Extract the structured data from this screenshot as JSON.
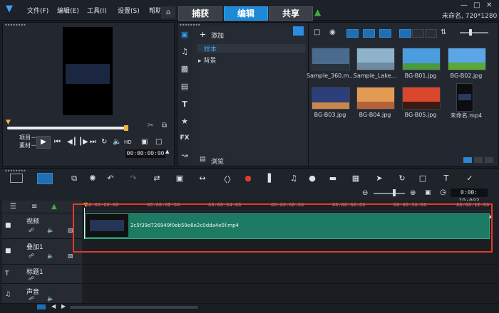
{
  "menu": {
    "items": [
      {
        "label": "文件(F)"
      },
      {
        "label": "编辑(E)"
      },
      {
        "label": "工具(I)"
      },
      {
        "label": "设置(S)"
      },
      {
        "label": "帮助"
      }
    ]
  },
  "tabs": [
    {
      "label": "捕获",
      "active": false
    },
    {
      "label": "编辑",
      "active": true
    },
    {
      "label": "共享",
      "active": false
    }
  ],
  "project_info": "未命名, 720*1280",
  "preview": {
    "mode_project": "项目－",
    "mode_clip": "素材－",
    "timecode": "00:00:00:00"
  },
  "library": {
    "add_label": "添加",
    "folders": [
      "样本",
      "背景"
    ],
    "browse_label": "浏览",
    "items": [
      {
        "label": "Sample_360.m..."
      },
      {
        "label": "Sample_Lake..."
      },
      {
        "label": "BG-B01.jpg"
      },
      {
        "label": "BG-B02.jpg"
      },
      {
        "label": "BG-B03.jpg"
      },
      {
        "label": "BG-B04.jpg"
      },
      {
        "label": "BG-B05.jpg"
      },
      {
        "label": "未命名.mp4"
      }
    ]
  },
  "timeline": {
    "timecode": "0:00: 19:003",
    "ruler_ticks": [
      "00:00:00:00",
      "00:00:02:00",
      "00:00:04:00",
      "00:00:06:00",
      "00:00:08:00",
      "00:00:10:00",
      "00:00:12:00"
    ],
    "tracks": [
      {
        "label": "视频"
      },
      {
        "label": "叠加1"
      },
      {
        "label": "标题1"
      },
      {
        "label": "声音"
      }
    ],
    "clip_name": "2c5f39d726949f0eb59e8e2c0dda4e5f.mp4"
  },
  "colors": {
    "accent": "#1f89d9",
    "clip": "#1e7b63",
    "highlight": "#e53a2a",
    "home_arrow": "#3bb23b"
  }
}
